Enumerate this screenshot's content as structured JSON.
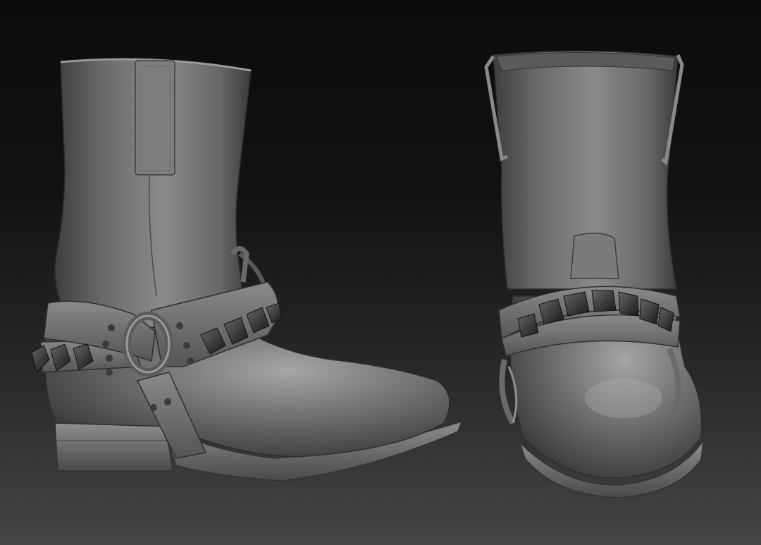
{
  "scene": {
    "description_name": "boots-render",
    "background_top": "#0c0c0c",
    "background_bottom": "#454545",
    "material_color": "#7a7a7a",
    "stud_color": "#2b2b2b",
    "views": [
      "side-view",
      "front-view"
    ]
  }
}
